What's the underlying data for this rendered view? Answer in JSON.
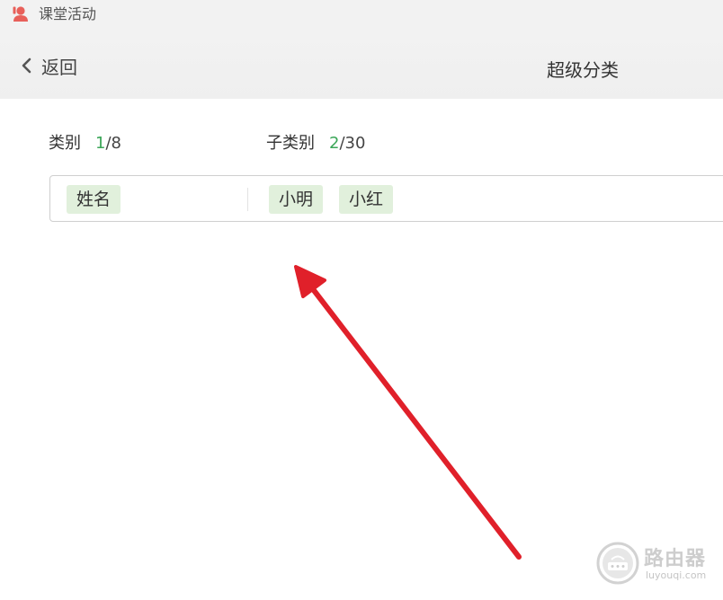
{
  "window": {
    "app_title": "课堂活动",
    "icon": "user-icon",
    "icon_color": "#e8605a"
  },
  "header": {
    "back_label": "返回",
    "back_icon": "chevron-left-icon",
    "page_title": "超级分类"
  },
  "counts": {
    "category": {
      "label": "类别",
      "current": "1",
      "total": "/8"
    },
    "subcategory": {
      "label": "子类别",
      "current": "2",
      "total": "/30"
    }
  },
  "tags": {
    "category_tags": [
      "姓名"
    ],
    "subcategory_tags": [
      "小明",
      "小红"
    ]
  },
  "colors": {
    "accent_green": "#3aa657",
    "tag_background": "#e1f0dc",
    "annotation_arrow": "#e0202a"
  },
  "watermark": {
    "name": "路由器",
    "url": "luyouqi.com"
  }
}
